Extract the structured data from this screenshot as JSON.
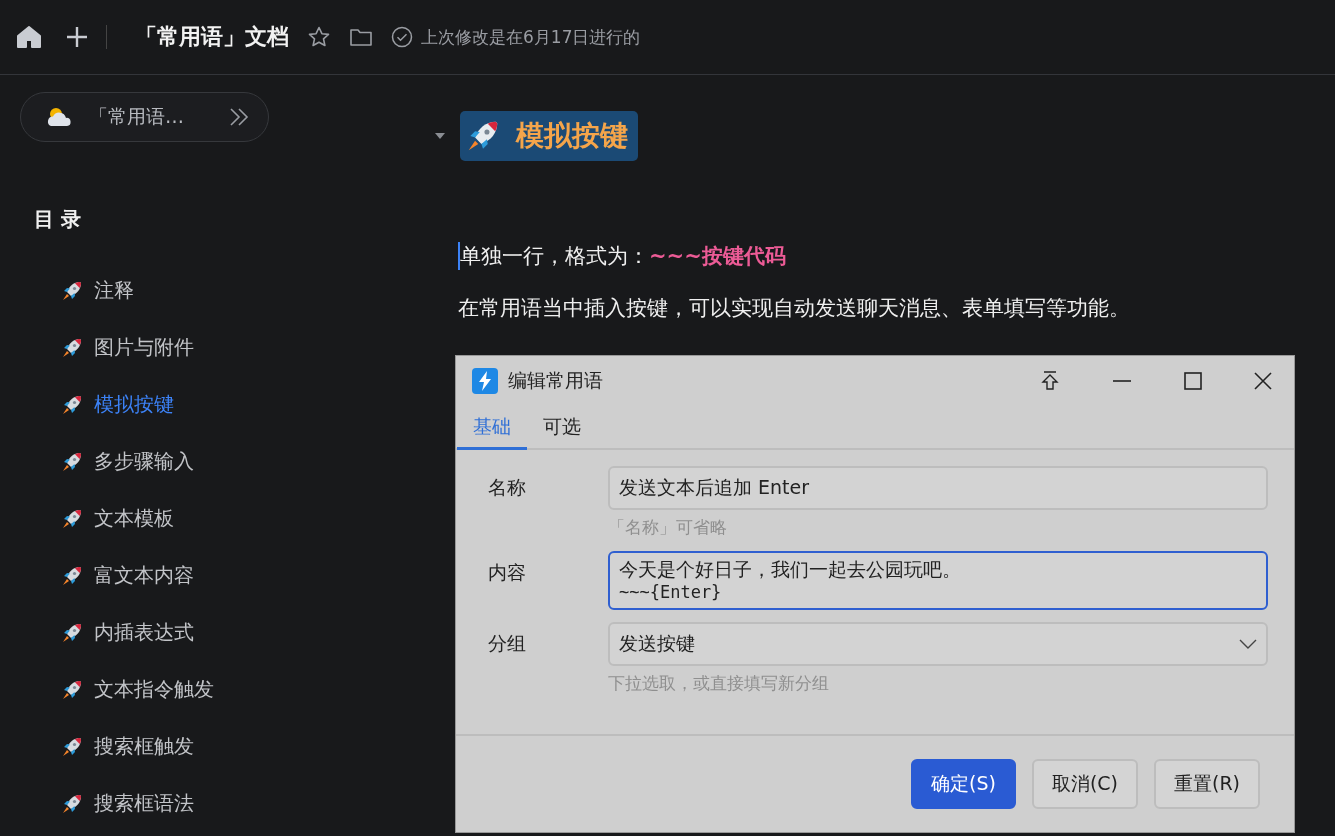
{
  "toolbar": {
    "title": "「常用语」文档",
    "status": "上次修改是在6月17日进行的"
  },
  "sidebar": {
    "doc_button": "「常用语…",
    "toc_title": "目 录",
    "items": [
      {
        "label": "注释",
        "selected": false
      },
      {
        "label": "图片与附件",
        "selected": false
      },
      {
        "label": "模拟按键",
        "selected": true
      },
      {
        "label": "多步骤输入",
        "selected": false
      },
      {
        "label": "文本模板",
        "selected": false
      },
      {
        "label": "富文本内容",
        "selected": false
      },
      {
        "label": "内插表达式",
        "selected": false
      },
      {
        "label": "文本指令触发",
        "selected": false
      },
      {
        "label": "搜索框触发",
        "selected": false
      },
      {
        "label": "搜索框语法",
        "selected": false
      }
    ]
  },
  "content": {
    "heading": "模拟按键",
    "format_line": {
      "text": "单独一行，格式为：",
      "code": "~~~按键代码"
    },
    "paragraph": "在常用语当中插入按键，可以实现自动发送聊天消息、表单填写等功能。"
  },
  "dialog": {
    "title": "编辑常用语",
    "tabs": [
      {
        "label": "基础",
        "selected": true
      },
      {
        "label": "可选",
        "selected": false
      }
    ],
    "fields": [
      {
        "kind": "text",
        "label": "名称",
        "value": "发送文本后追加 Enter",
        "hint": "「名称」可省略",
        "focused": false
      },
      {
        "kind": "textarea",
        "label": "内容",
        "lines": [
          {
            "kind": "text",
            "text": "今天是个好日子，我们一起去公园玩吧。"
          },
          {
            "kind": "code",
            "text": "~~~{Enter}"
          }
        ],
        "focused": true
      },
      {
        "kind": "select",
        "label": "分组",
        "value": "发送按键",
        "hint": "下拉选取，或直接填写新分组",
        "focused": false
      }
    ],
    "buttons": [
      {
        "label": "确定(S)",
        "primary": true
      },
      {
        "label": "取消(C)",
        "primary": false
      },
      {
        "label": "重置(R)",
        "primary": false
      }
    ]
  }
}
